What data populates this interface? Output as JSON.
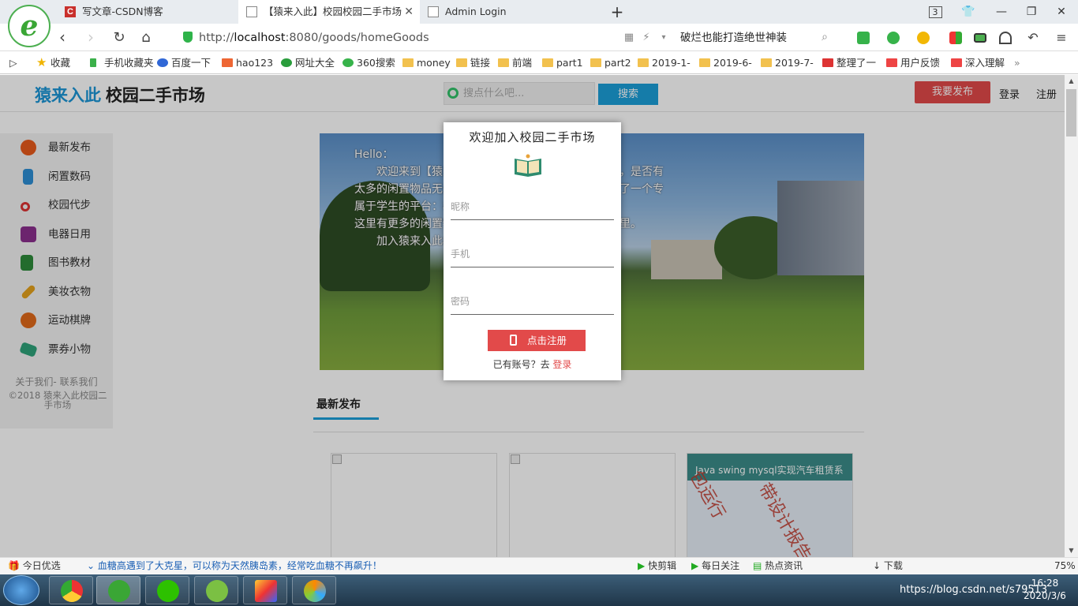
{
  "browser": {
    "tabs": [
      {
        "label": "写文章-CSDN博客"
      },
      {
        "label": "【猿来入此】校园校园二手市场"
      },
      {
        "label": "Admin Login"
      }
    ],
    "new_tab": "+",
    "tab_count": "3",
    "url_prefix": "http://",
    "url_host": "localhost",
    "url_rest": ":8080/goods/homeGoods",
    "search_text": "破烂也能打造绝世神装",
    "bookmarks": [
      "收藏",
      "手机收藏夹",
      "百度一下",
      "hao123",
      "网址大全",
      "360搜索",
      "money",
      "链接",
      "前端",
      "part1",
      "part2",
      "2019-1-",
      "2019-6-",
      "2019-7-",
      "整理了一",
      "用户反馈",
      "深入理解"
    ],
    "more_bookmarks": "»"
  },
  "site": {
    "brand_highlight": "猿来入此",
    "brand_rest": " 校园二手市场",
    "search_placeholder": "搜点什么吧...",
    "search_button": "搜索",
    "publish_button": "我要发布",
    "login": "登录",
    "register": "注册",
    "categories": [
      "最新发布",
      "闲置数码",
      "校园代步",
      "电器日用",
      "图书教材",
      "美妆衣物",
      "运动棋牌",
      "票券小物"
    ],
    "footer_links": "关于我们- 联系我们",
    "copyright": "©2018 猿来入此校园二手市场",
    "banner_text": "Hello：\n　　欢迎来到【猿来入此】校园二手市场，毕业季的你，是否有太多的闲置物品无处安放？我们的校园服务，我们打造了一个专属于学生的平台：校园二手市场\n这里有更多的闲置物品，你想卖的，你想要的，都在这里。\n　　加入猿来入此校园二手市场，留下你的身影。",
    "section_title": "最新发布",
    "card3_title": "Java swing mysql实现汽车租赁系统",
    "card3_watermark1": "包运行",
    "card3_watermark2": "带设计报告"
  },
  "modal": {
    "title": "欢迎加入校园二手市场",
    "nickname_placeholder": "昵称",
    "phone_placeholder": "手机",
    "password_placeholder": "密码",
    "register_button": "点击注册",
    "has_account": "已有账号？去 ",
    "login_link": "登录"
  },
  "statusbar": {
    "today": "今日优选",
    "news": "血糖高遇到了大克星，可以称为天然胰岛素，经常吃血糖不再飙升！",
    "kuaijian": "快剪辑",
    "daily": "每日关注",
    "hot": "热点资讯",
    "download": "下载",
    "zoom": "75%"
  },
  "taskbar": {
    "time": "16:28",
    "date": "2020/3/6",
    "watermark": "https://blog.csdn.net/s79513"
  }
}
